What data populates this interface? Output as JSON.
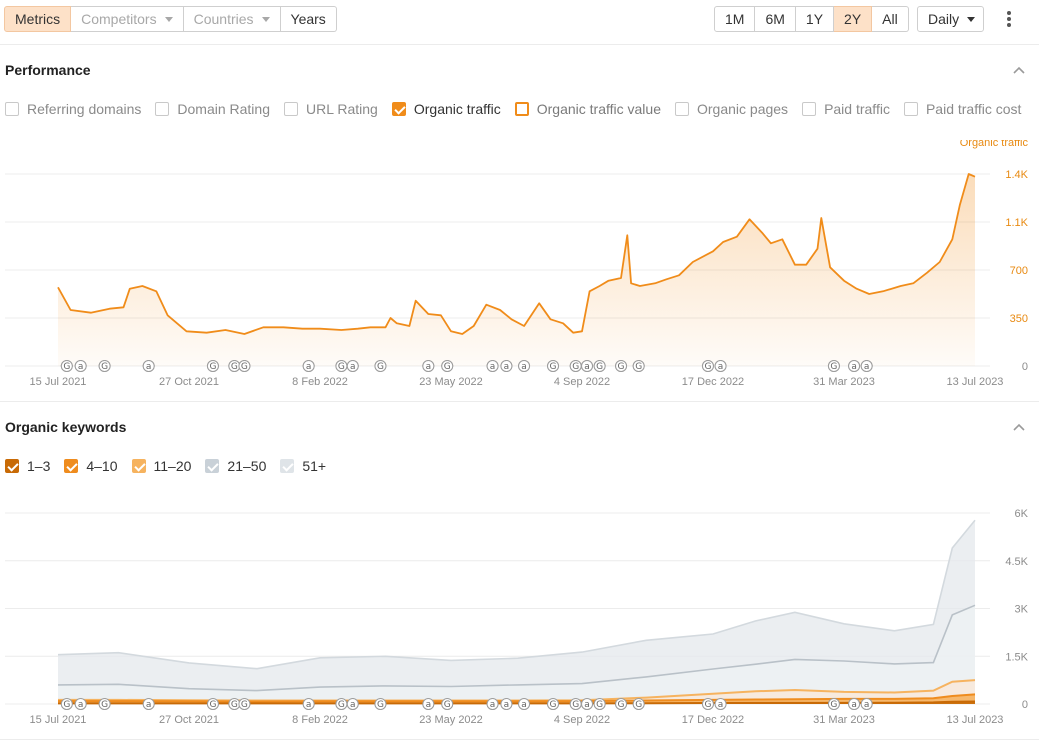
{
  "toolbar": {
    "tabs": [
      {
        "label": "Metrics",
        "state": "active",
        "dropdown": false
      },
      {
        "label": "Competitors",
        "state": "disabled",
        "dropdown": true
      },
      {
        "label": "Countries",
        "state": "disabled",
        "dropdown": true
      },
      {
        "label": "Years",
        "state": "normal",
        "dropdown": false
      }
    ],
    "ranges": [
      {
        "label": "1M",
        "active": false
      },
      {
        "label": "6M",
        "active": false
      },
      {
        "label": "1Y",
        "active": false
      },
      {
        "label": "2Y",
        "active": true
      },
      {
        "label": "All",
        "active": false
      }
    ],
    "interval": "Daily"
  },
  "colors": {
    "orange": "#f08c1a",
    "orange_dark": "#c86a06",
    "orange_light": "#f6b35f",
    "grey": "#c9d1d8",
    "grey_light": "#dfe4e8",
    "active_bg": "#fde1c8"
  },
  "performance": {
    "title": "Performance",
    "metrics": [
      {
        "label": "Referring domains",
        "checked": false,
        "style": "plain"
      },
      {
        "label": "Domain Rating",
        "checked": false,
        "style": "plain"
      },
      {
        "label": "URL Rating",
        "checked": false,
        "style": "plain"
      },
      {
        "label": "Organic traffic",
        "checked": true,
        "style": "filled-orange"
      },
      {
        "label": "Organic traffic value",
        "checked": false,
        "style": "outline-orange"
      },
      {
        "label": "Organic pages",
        "checked": false,
        "style": "plain"
      },
      {
        "label": "Paid traffic",
        "checked": false,
        "style": "plain"
      },
      {
        "label": "Paid traffic cost",
        "checked": false,
        "style": "plain"
      }
    ]
  },
  "keywords": {
    "title": "Organic keywords",
    "buckets": [
      {
        "label": "1–3",
        "checked": true,
        "color": "#c86a06"
      },
      {
        "label": "4–10",
        "checked": true,
        "color": "#ef8c1e"
      },
      {
        "label": "11–20",
        "checked": true,
        "color": "#f6b35f"
      },
      {
        "label": "21–50",
        "checked": true,
        "color": "#c9d1d8"
      },
      {
        "label": "51+",
        "checked": true,
        "color": "#dfe4e8"
      }
    ]
  },
  "chart_data": [
    {
      "type": "area",
      "series": [
        {
          "name": "Organic traffic",
          "x": [
            "2021-07-15",
            "2021-07-25",
            "2021-08-10",
            "2021-08-25",
            "2021-09-05",
            "2021-09-10",
            "2021-09-20",
            "2021-10-01",
            "2021-10-10",
            "2021-10-25",
            "2021-11-10",
            "2021-11-25",
            "2021-12-10",
            "2021-12-25",
            "2022-01-10",
            "2022-01-25",
            "2022-02-08",
            "2022-02-25",
            "2022-03-10",
            "2022-03-20",
            "2022-04-01",
            "2022-04-05",
            "2022-04-10",
            "2022-04-20",
            "2022-04-25",
            "2022-05-05",
            "2022-05-15",
            "2022-05-23",
            "2022-06-01",
            "2022-06-10",
            "2022-06-20",
            "2022-07-01",
            "2022-07-10",
            "2022-07-20",
            "2022-08-01",
            "2022-08-10",
            "2022-08-20",
            "2022-08-28",
            "2022-09-04",
            "2022-09-10",
            "2022-09-18",
            "2022-09-25",
            "2022-10-05",
            "2022-10-10",
            "2022-10-13",
            "2022-10-20",
            "2022-11-01",
            "2022-11-10",
            "2022-11-20",
            "2022-12-01",
            "2022-12-17",
            "2022-12-25",
            "2023-01-05",
            "2023-01-15",
            "2023-01-25",
            "2023-02-01",
            "2023-02-10",
            "2023-02-20",
            "2023-03-01",
            "2023-03-10",
            "2023-03-13",
            "2023-03-20",
            "2023-03-31",
            "2023-04-10",
            "2023-04-20",
            "2023-05-01",
            "2023-05-15",
            "2023-05-25",
            "2023-06-05",
            "2023-06-15",
            "2023-06-25",
            "2023-07-01",
            "2023-07-08",
            "2023-07-13"
          ],
          "values": [
            590,
            420,
            400,
            430,
            440,
            580,
            600,
            560,
            380,
            260,
            250,
            270,
            240,
            290,
            290,
            280,
            280,
            270,
            280,
            290,
            290,
            360,
            320,
            300,
            490,
            390,
            380,
            260,
            240,
            300,
            460,
            420,
            350,
            300,
            470,
            350,
            320,
            250,
            260,
            560,
            600,
            640,
            660,
            980,
            620,
            600,
            620,
            650,
            680,
            780,
            860,
            930,
            970,
            1100,
            1000,
            920,
            950,
            760,
            760,
            880,
            1110,
            740,
            640,
            580,
            540,
            560,
            600,
            620,
            700,
            780,
            950,
            1210,
            1440,
            1420
          ]
        }
      ],
      "y_ticks": [
        "0",
        "350",
        "700",
        "1.1K",
        "1.4K"
      ],
      "y_axis_label": "Organic traffic",
      "ylim": [
        0,
        1440
      ],
      "x_ticks": [
        "15 Jul 2021",
        "27 Oct 2021",
        "8 Feb 2022",
        "23 May 2022",
        "4 Sep 2022",
        "17 Dec 2022",
        "31 Mar 2023",
        "13 Jul 2023"
      ],
      "annotations": [
        "G",
        "a",
        "G",
        "a",
        "G",
        "G",
        "G",
        "a",
        "G",
        "a",
        "G",
        "a",
        "G",
        "a",
        "a",
        "a",
        "G",
        "G",
        "a",
        "G",
        "G",
        "G",
        "G",
        "a",
        "G",
        "a",
        "a"
      ],
      "grid": true
    },
    {
      "type": "area",
      "stacked": true,
      "categories_x": [
        "2021-07-15",
        "2021-09-01",
        "2021-10-27",
        "2021-12-20",
        "2022-02-08",
        "2022-04-01",
        "2022-05-23",
        "2022-07-15",
        "2022-09-04",
        "2022-10-25",
        "2022-12-17",
        "2023-01-20",
        "2023-02-20",
        "2023-03-31",
        "2023-05-10",
        "2023-06-10",
        "2023-06-25",
        "2023-07-13"
      ],
      "series": [
        {
          "name": "1–3",
          "values": [
            20,
            20,
            20,
            20,
            20,
            20,
            20,
            20,
            20,
            25,
            30,
            35,
            35,
            35,
            40,
            50,
            70,
            80
          ]
        },
        {
          "name": "4–10",
          "values": [
            90,
            90,
            85,
            80,
            85,
            85,
            85,
            85,
            90,
            110,
            130,
            140,
            150,
            160,
            160,
            180,
            250,
            300
          ]
        },
        {
          "name": "11–20",
          "values": [
            130,
            130,
            120,
            110,
            110,
            110,
            110,
            110,
            120,
            200,
            320,
            400,
            440,
            380,
            360,
            420,
            700,
            750
          ]
        },
        {
          "name": "21–50",
          "values": [
            600,
            620,
            480,
            420,
            530,
            570,
            550,
            600,
            640,
            850,
            1100,
            1250,
            1400,
            1350,
            1260,
            1300,
            2800,
            3100
          ]
        },
        {
          "name": "51+",
          "values": [
            1550,
            1610,
            1290,
            1110,
            1450,
            1500,
            1370,
            1440,
            1630,
            2000,
            2200,
            2610,
            2880,
            2520,
            2300,
            2500,
            4900,
            5770
          ]
        }
      ],
      "y_ticks": [
        "0",
        "1.5K",
        "3K",
        "4.5K",
        "6K"
      ],
      "ylim": [
        0,
        6000
      ],
      "x_ticks": [
        "15 Jul 2021",
        "27 Oct 2021",
        "8 Feb 2022",
        "23 May 2022",
        "4 Sep 2022",
        "17 Dec 2022",
        "31 Mar 2023",
        "13 Jul 2023"
      ],
      "annotations": [
        "G",
        "a",
        "G",
        "a",
        "G",
        "G",
        "G",
        "a",
        "G",
        "a",
        "G",
        "a",
        "G",
        "a",
        "a",
        "a",
        "G",
        "G",
        "a",
        "G",
        "G",
        "G",
        "G",
        "a",
        "G",
        "a",
        "a"
      ],
      "grid": true
    }
  ]
}
